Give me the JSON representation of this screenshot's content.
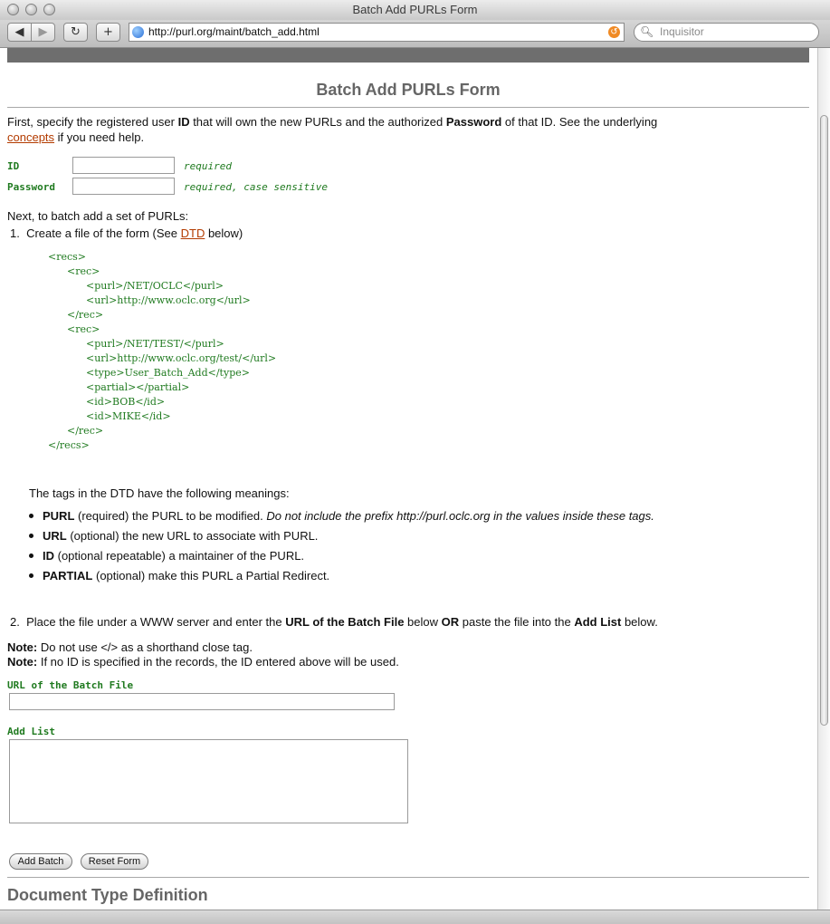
{
  "window": {
    "title": "Batch Add PURLs Form"
  },
  "toolbar": {
    "back_icon": "back-arrow-icon",
    "forward_icon": "forward-arrow-icon",
    "reload_icon": "reload-icon",
    "add_bookmark_icon": "plus-icon",
    "url": "http://purl.org/maint/batch_add.html",
    "search_placeholder": "Inquisitor"
  },
  "page": {
    "title": "Batch Add PURLs Form",
    "intro": {
      "t1": "First, specify the registered user ",
      "b1": "ID",
      "t2": " that will own the new PURLs and the authorized ",
      "b2": "Password",
      "t3": " of that ID. See the underlying",
      "link": "concepts",
      "t4": " if you need help."
    },
    "id_field": {
      "label": "ID",
      "hint": "required",
      "value": ""
    },
    "password_field": {
      "label": "Password",
      "hint": "required, case sensitive",
      "value": ""
    },
    "next_text": "Next, to batch add a set of PURLs:",
    "step1": {
      "num": "1.",
      "t1": "Create a file of the form (See ",
      "link": "DTD",
      "t2": " below)"
    },
    "code_lines": [
      "<recs>",
      "<rec>",
      "<purl>/NET/OCLC</purl>",
      "<url>http://www.oclc.org</url>",
      "</rec>",
      "<rec>",
      "<purl>/NET/TEST/</purl>",
      "<url>http://www.oclc.org/test/</url>",
      "<type>User_Batch_Add</type>",
      "<partial></partial>",
      "<id>BOB</id>",
      "<id>MIKE</id>",
      "</rec>",
      "</recs>"
    ],
    "tags_intro": "The tags in the DTD have the following meanings:",
    "tags": [
      {
        "name": "PURL",
        "desc": " (required) the PURL to be modified. ",
        "note": "Do not include the prefix http://purl.oclc.org in the values inside these tags."
      },
      {
        "name": "URL",
        "desc": " (optional) the new URL to associate with PURL.",
        "note": ""
      },
      {
        "name": "ID",
        "desc": " (optional repeatable) a maintainer of the PURL.",
        "note": ""
      },
      {
        "name": "PARTIAL",
        "desc": " (optional) make this PURL a Partial Redirect.",
        "note": ""
      }
    ],
    "step2": {
      "num": "2.",
      "t1": "Place the file under a WWW server and enter the ",
      "b1": "URL of the Batch File",
      "t2": " below ",
      "b2": "OR",
      "t3": " paste the file into the ",
      "b3": "Add List",
      "t4": " below."
    },
    "note1": {
      "label": "Note:",
      "text": " Do not use </> as a shorthand close tag."
    },
    "note2": {
      "label": "Note:",
      "text": " If no ID is specified in the records, the ID entered above will be used."
    },
    "batch_url_field": {
      "label": "URL of the Batch File",
      "value": ""
    },
    "add_list_field": {
      "label": "Add List",
      "value": ""
    },
    "buttons": {
      "add_batch": "Add Batch",
      "reset_form": "Reset Form"
    },
    "dtd_heading": "Document Type Definition"
  }
}
